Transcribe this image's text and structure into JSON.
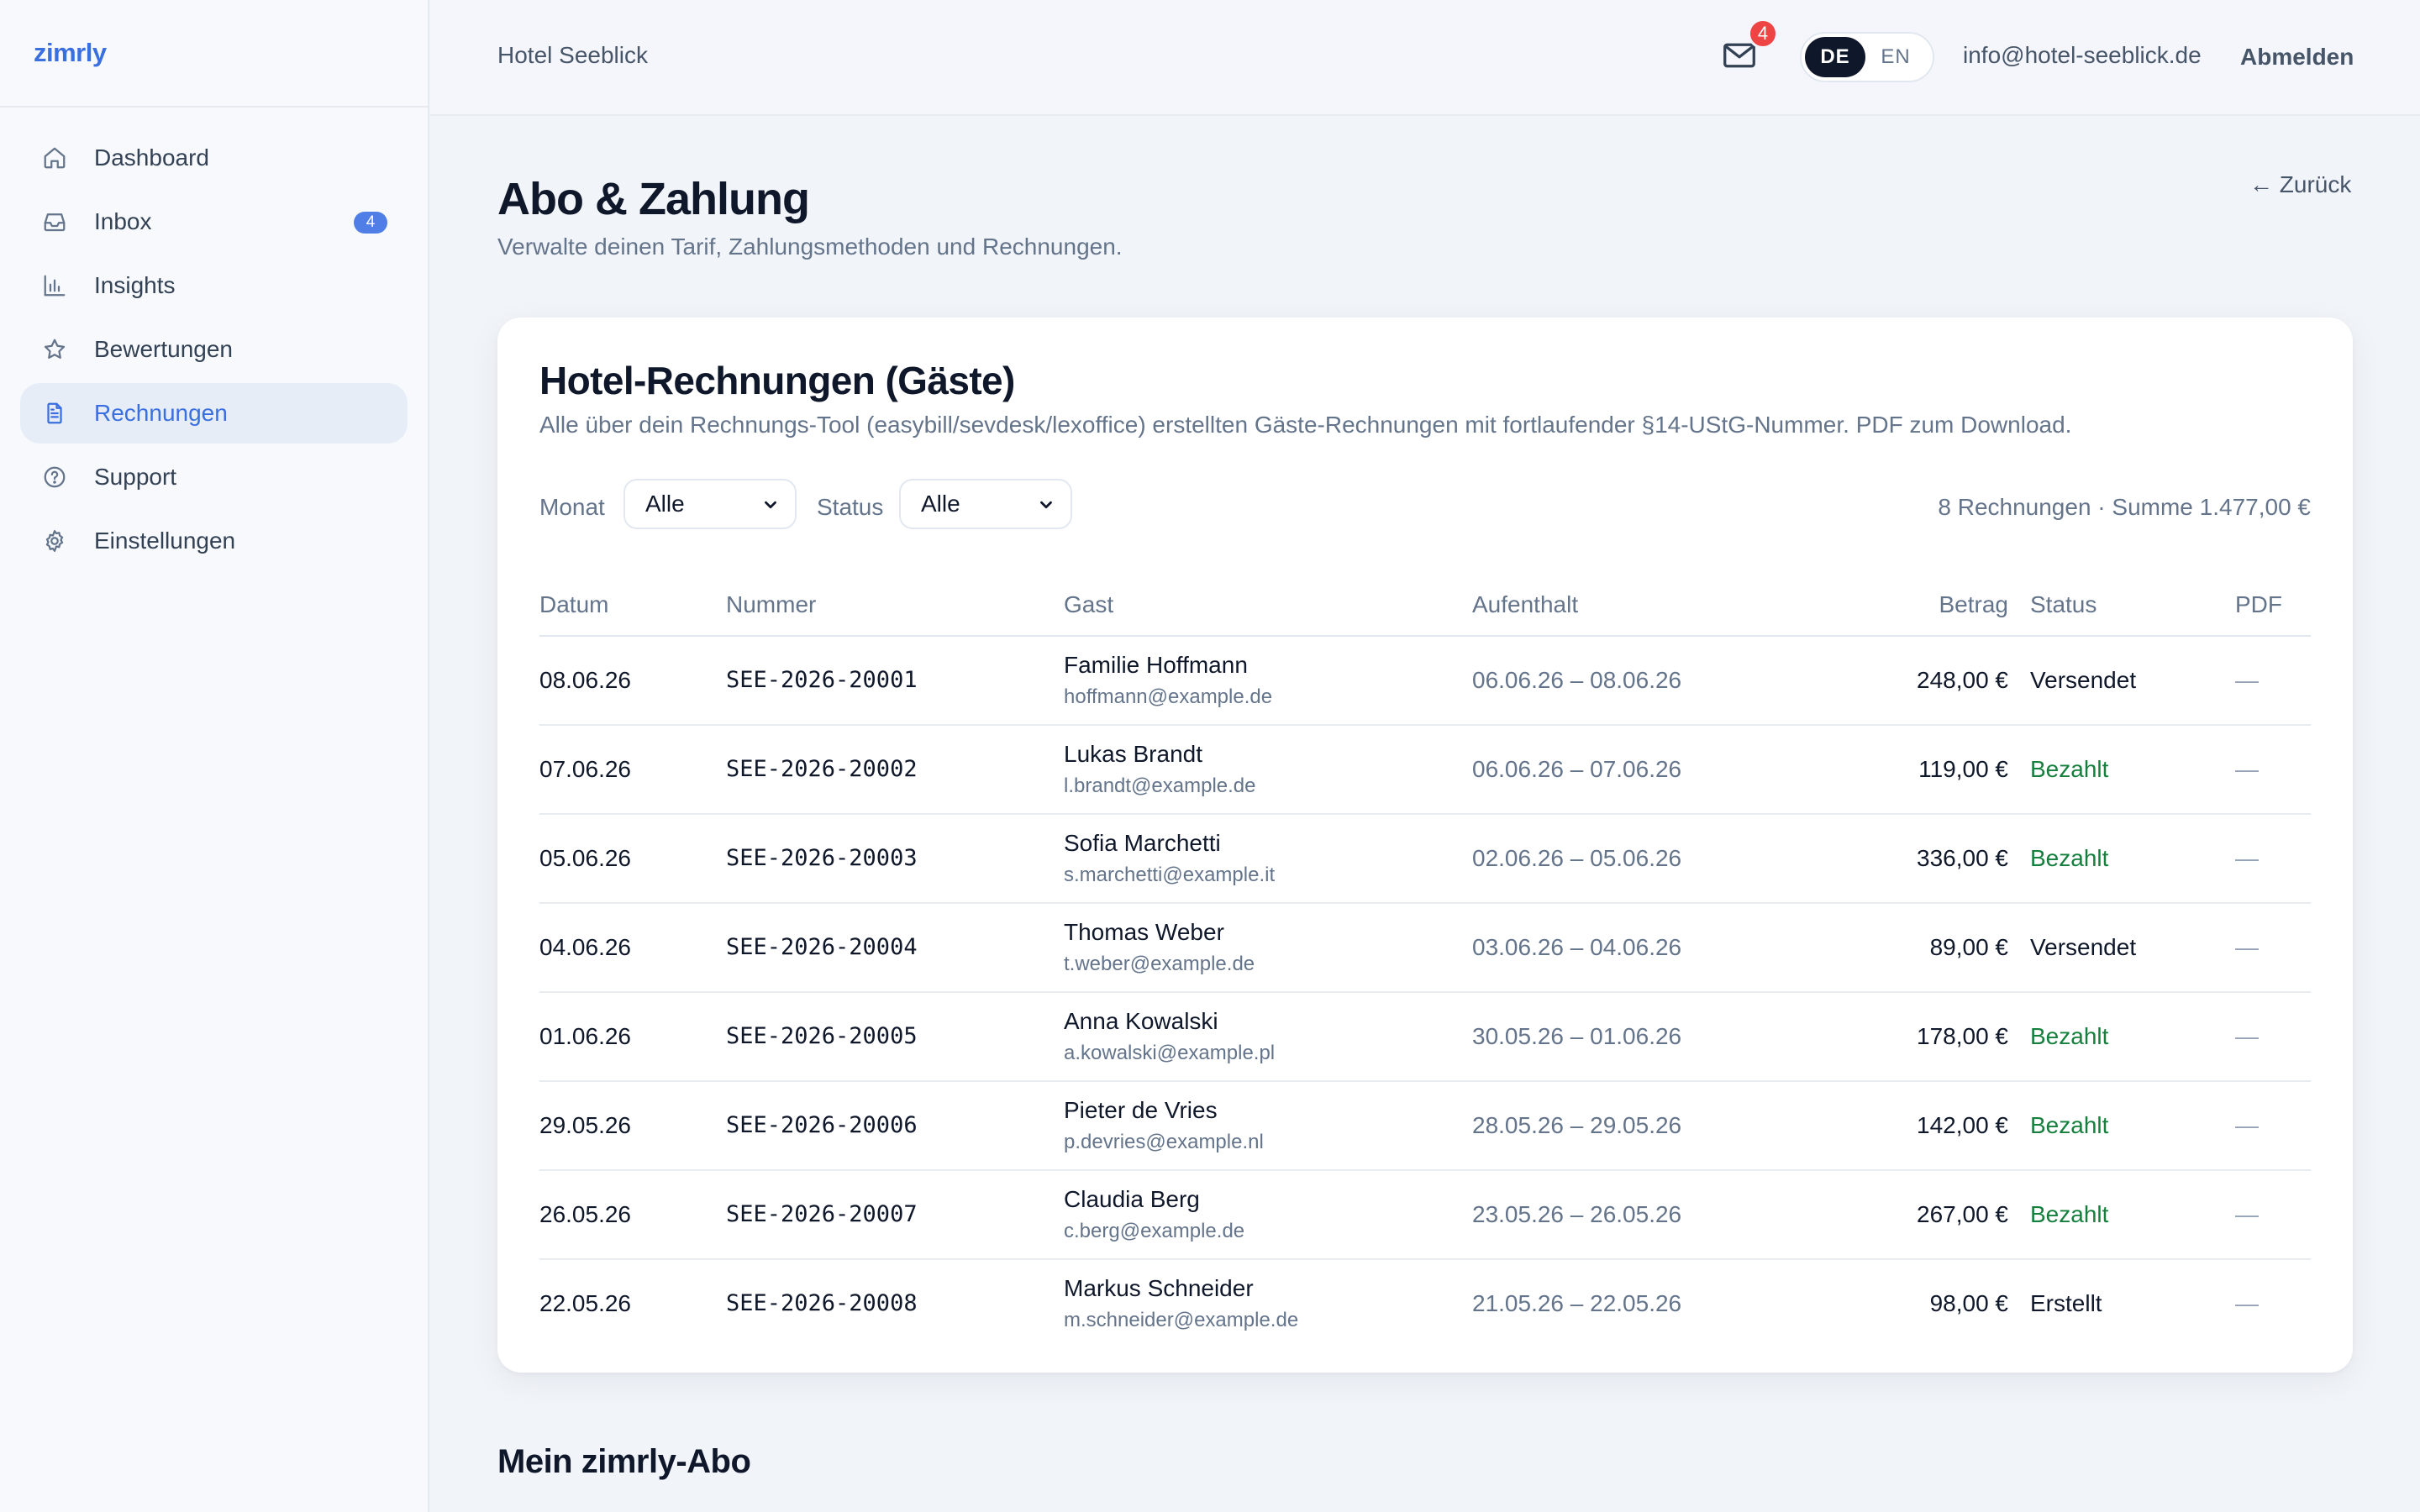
{
  "app": {
    "brand": "zimrly"
  },
  "sidebar": {
    "items": [
      {
        "label": "Dashboard",
        "icon": "home-icon"
      },
      {
        "label": "Inbox",
        "icon": "inbox-icon",
        "badge": "4"
      },
      {
        "label": "Insights",
        "icon": "bar-chart-icon"
      },
      {
        "label": "Bewertungen",
        "icon": "star-icon"
      },
      {
        "label": "Rechnungen",
        "icon": "document-icon",
        "active": true
      },
      {
        "label": "Support",
        "icon": "help-circle-icon"
      },
      {
        "label": "Einstellungen",
        "icon": "gear-icon"
      }
    ]
  },
  "topbar": {
    "hotel": "Hotel Seeblick",
    "mail_count": "4",
    "lang_de": "DE",
    "lang_en": "EN",
    "email": "info@hotel-seeblick.de",
    "logout": "Abmelden"
  },
  "page": {
    "title": "Abo & Zahlung",
    "subtitle": "Verwalte deinen Tarif, Zahlungsmethoden und Rechnungen.",
    "back": "← Zurück"
  },
  "invoices": {
    "title": "Hotel-Rechnungen (Gäste)",
    "subtitle": "Alle über dein Rechnungs-Tool (easybill/sevdesk/lexoffice) erstellten Gäste-Rechnungen mit fortlaufender §14-UStG-Nummer. PDF zum Download.",
    "filters": {
      "month_label": "Monat",
      "month_value": "Alle",
      "status_label": "Status",
      "status_value": "Alle"
    },
    "summary": "8 Rechnungen · Summe 1.477,00 €",
    "columns": {
      "date": "Datum",
      "number": "Nummer",
      "guest": "Gast",
      "stay": "Aufenthalt",
      "amount": "Betrag",
      "status": "Status",
      "pdf": "PDF"
    },
    "rows": [
      {
        "date": "08.06.26",
        "number": "SEE-2026-20001",
        "guest": "Familie Hoffmann",
        "email": "hoffmann@example.de",
        "stay": "06.06.26 – 08.06.26",
        "amount": "248,00 €",
        "status": "Versendet",
        "paid": false,
        "pdf": "—"
      },
      {
        "date": "07.06.26",
        "number": "SEE-2026-20002",
        "guest": "Lukas Brandt",
        "email": "l.brandt@example.de",
        "stay": "06.06.26 – 07.06.26",
        "amount": "119,00 €",
        "status": "Bezahlt",
        "paid": true,
        "pdf": "—"
      },
      {
        "date": "05.06.26",
        "number": "SEE-2026-20003",
        "guest": "Sofia Marchetti",
        "email": "s.marchetti@example.it",
        "stay": "02.06.26 – 05.06.26",
        "amount": "336,00 €",
        "status": "Bezahlt",
        "paid": true,
        "pdf": "—"
      },
      {
        "date": "04.06.26",
        "number": "SEE-2026-20004",
        "guest": "Thomas Weber",
        "email": "t.weber@example.de",
        "stay": "03.06.26 – 04.06.26",
        "amount": "89,00 €",
        "status": "Versendet",
        "paid": false,
        "pdf": "—"
      },
      {
        "date": "01.06.26",
        "number": "SEE-2026-20005",
        "guest": "Anna Kowalski",
        "email": "a.kowalski@example.pl",
        "stay": "30.05.26 – 01.06.26",
        "amount": "178,00 €",
        "status": "Bezahlt",
        "paid": true,
        "pdf": "—"
      },
      {
        "date": "29.05.26",
        "number": "SEE-2026-20006",
        "guest": "Pieter de Vries",
        "email": "p.devries@example.nl",
        "stay": "28.05.26 – 29.05.26",
        "amount": "142,00 €",
        "status": "Bezahlt",
        "paid": true,
        "pdf": "—"
      },
      {
        "date": "26.05.26",
        "number": "SEE-2026-20007",
        "guest": "Claudia Berg",
        "email": "c.berg@example.de",
        "stay": "23.05.26 – 26.05.26",
        "amount": "267,00 €",
        "status": "Bezahlt",
        "paid": true,
        "pdf": "—"
      },
      {
        "date": "22.05.26",
        "number": "SEE-2026-20008",
        "guest": "Markus Schneider",
        "email": "m.schneider@example.de",
        "stay": "21.05.26 – 22.05.26",
        "amount": "98,00 €",
        "status": "Erstellt",
        "paid": false,
        "pdf": "—"
      }
    ]
  },
  "abo": {
    "title": "Mein zimrly-Abo"
  },
  "colors": {
    "accent": "#3a6fe0",
    "paid": "#15803d",
    "badge": "#ef4444",
    "text": "#0f172a",
    "muted": "#64748b"
  }
}
